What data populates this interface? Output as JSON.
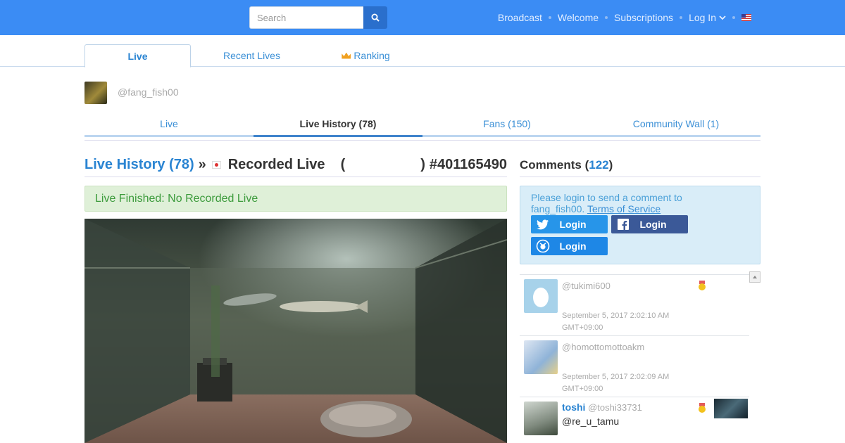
{
  "header": {
    "search_placeholder": "Search",
    "nav": [
      "Broadcast",
      "Welcome",
      "Subscriptions",
      "Log In"
    ]
  },
  "main_tabs": [
    {
      "label": "Live",
      "active": true
    },
    {
      "label": "Recent Lives",
      "active": false
    },
    {
      "label": "Ranking",
      "active": false
    }
  ],
  "profile": {
    "handle": "@fang_fish00"
  },
  "sub_tabs": [
    {
      "label": "Live",
      "active": false
    },
    {
      "label": "Live History (78)",
      "active": true
    },
    {
      "label": "Fans (150)",
      "active": false
    },
    {
      "label": "Community Wall (1)",
      "active": false
    }
  ],
  "live": {
    "history_link": "Live History (78)",
    "separator": "»",
    "title": "Recorded Live",
    "paren_open": "(",
    "paren_close": ")",
    "id": "#401165490",
    "status": "Live Finished: No Recorded Live"
  },
  "comments": {
    "heading": "Comments",
    "count": "122",
    "login_msg": "Please login to send a comment to fang_fish00.",
    "terms": "Terms of Service",
    "login_label": "Login",
    "items": [
      {
        "name": "",
        "handle": "@tukimi600",
        "time": "September 5, 2017 2:02:10 AM",
        "tz": "GMT+09:00",
        "text": ""
      },
      {
        "name": "",
        "handle": "@homottomottoakm",
        "time": "September 5, 2017 2:02:09 AM",
        "tz": "GMT+09:00",
        "text": ""
      },
      {
        "name": "toshi",
        "handle": "@toshi33731",
        "time": "",
        "tz": "",
        "text": "@re_u_tamu"
      }
    ]
  },
  "colors": {
    "topbar": "#3b8cf4",
    "link": "#2a84d2",
    "alert_bg": "#dff0d8",
    "login_box": "#d9edf8"
  }
}
